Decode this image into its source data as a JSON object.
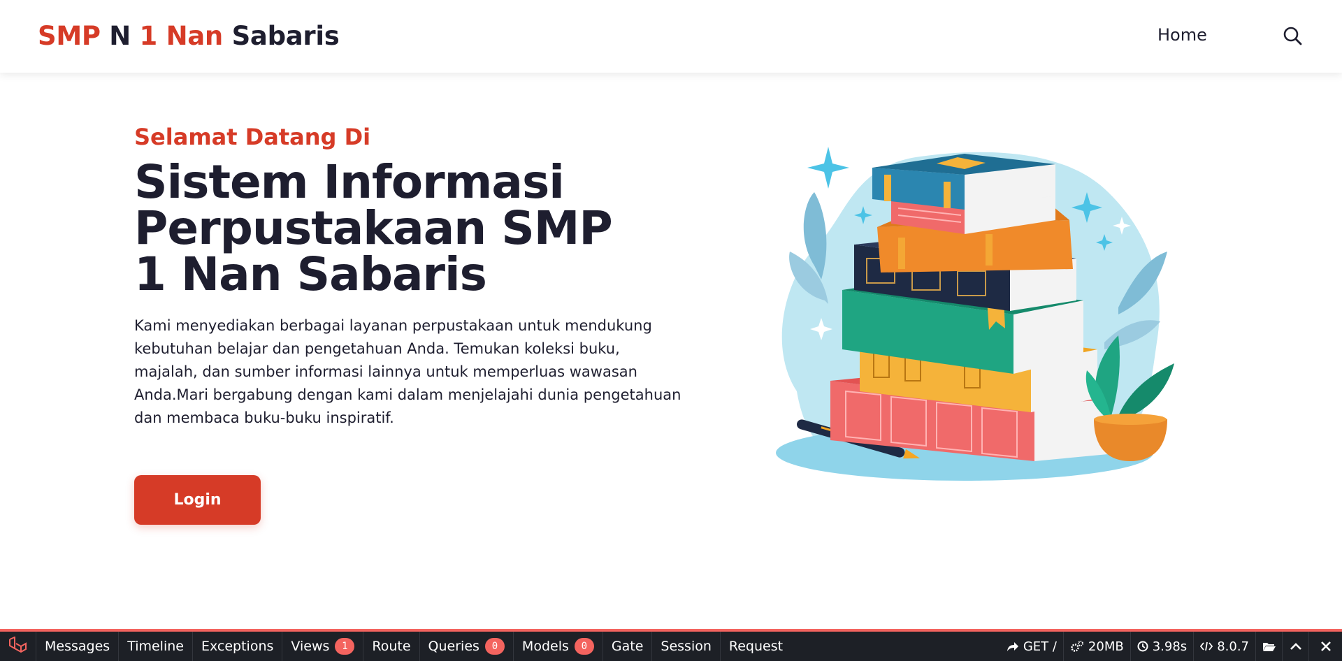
{
  "header": {
    "logo": {
      "part1": "SMP",
      "part2": "N",
      "part3": "1",
      "part4": "Nan",
      "part5": "Sabaris"
    },
    "nav": {
      "home": "Home"
    },
    "search_icon": "search-icon"
  },
  "hero": {
    "kicker": "Selamat Datang Di",
    "title": "Sistem Informasi Perpustakaan SMP 1 Nan Sabaris",
    "description": "Kami menyediakan berbagai layanan perpustakaan untuk mendukung kebutuhan belajar dan pengetahuan Anda. Temukan koleksi buku, majalah, dan sumber informasi lainnya untuk memperluas wawasan Anda.Mari bergabung dengan kami dalam menjelajahi dunia pengetahuan dan membaca buku-buku inspiratif.",
    "login_label": "Login",
    "illustration": "stack-of-books-illustration"
  },
  "debugbar": {
    "tabs": [
      {
        "label": "Messages"
      },
      {
        "label": "Timeline"
      },
      {
        "label": "Exceptions"
      },
      {
        "label": "Views",
        "badge": "1"
      },
      {
        "label": "Route"
      },
      {
        "label": "Queries",
        "badge": "0"
      },
      {
        "label": "Models",
        "badge": "0"
      },
      {
        "label": "Gate"
      },
      {
        "label": "Session"
      },
      {
        "label": "Request"
      }
    ],
    "request": "GET /",
    "memory": "20MB",
    "time": "3.98s",
    "php_version": "8.0.7"
  },
  "colors": {
    "brand_red": "#d63b27",
    "text_dark": "#1e1e2f",
    "debugbar_bg": "#1d2026",
    "debugbar_accent": "#f4645f"
  }
}
